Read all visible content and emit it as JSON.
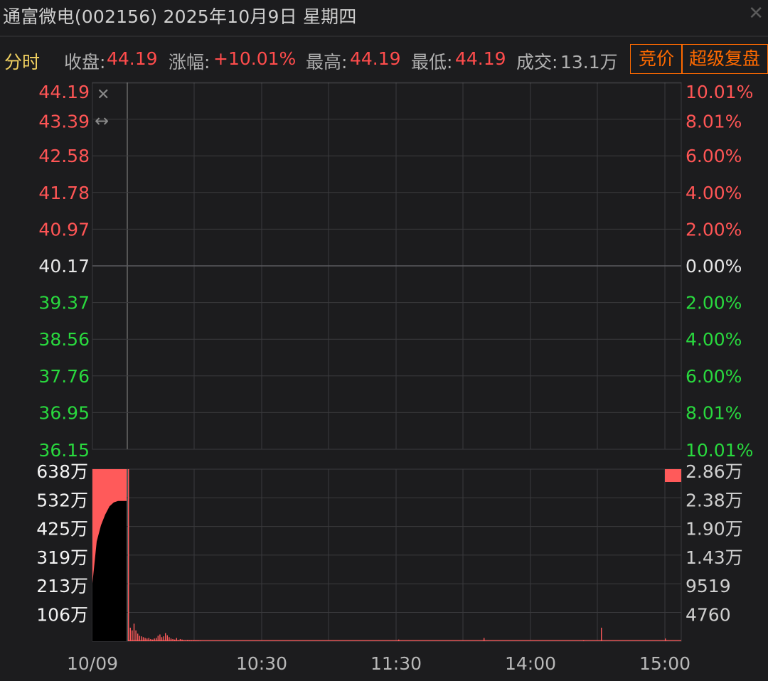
{
  "window": {
    "title": "通富微电(002156) 2025年10月9日 星期四",
    "close_icon": "close-icon"
  },
  "info": {
    "tab": "分时",
    "close_label": "收盘:",
    "close_value": "44.19",
    "change_label": "涨幅:",
    "change_value": "+10.01%",
    "high_label": "最高:",
    "high_value": "44.19",
    "low_label": "最低:",
    "low_value": "44.19",
    "volume_label": "成交:",
    "volume_value": "13.1万",
    "auction_button": "竞价",
    "super_replay_button": "超级复盘"
  },
  "chart_data": [
    {
      "type": "line",
      "name": "price",
      "ylim": [
        36.15,
        44.19
      ],
      "y_ticks_left": [
        "44.19",
        "43.39",
        "42.58",
        "41.78",
        "40.97",
        "40.17",
        "39.37",
        "38.56",
        "37.76",
        "36.95",
        "36.15"
      ],
      "y_ticks_right": [
        "10.01%",
        "8.01%",
        "6.00%",
        "4.00%",
        "2.00%",
        "0.00%",
        "2.00%",
        "4.00%",
        "6.00%",
        "8.01%",
        "10.01%"
      ],
      "x_ticks": [
        "10/09",
        "10:30",
        "11:30",
        "14:00",
        "15:00"
      ],
      "series": [
        {
          "x": [
            "09:30",
            "15:00"
          ],
          "values": [
            44.19,
            44.19
          ]
        }
      ]
    },
    {
      "type": "bar",
      "name": "volume",
      "y_ticks_left": [
        "638万",
        "532万",
        "425万",
        "319万",
        "213万",
        "106万"
      ],
      "y_ticks_right": [
        "2.86万",
        "2.38万",
        "1.90万",
        "1.43万",
        "9519",
        "4760"
      ],
      "ylim_left_wan": [
        0,
        638
      ],
      "auction_volume_wan": [
        215,
        370,
        430,
        470,
        500,
        515,
        520,
        520,
        520
      ],
      "ticks_wan": [
        638,
        50,
        40,
        65,
        40,
        28,
        20,
        18,
        15,
        12,
        10,
        12,
        8,
        6,
        10,
        12,
        20,
        25,
        15,
        18,
        30,
        22,
        15,
        10,
        8,
        6,
        12,
        4,
        8,
        6,
        4,
        3,
        5,
        3,
        2,
        1.5,
        1.2,
        1,
        0.8,
        0.6
      ],
      "close_auction_wan": 2.86
    }
  ]
}
